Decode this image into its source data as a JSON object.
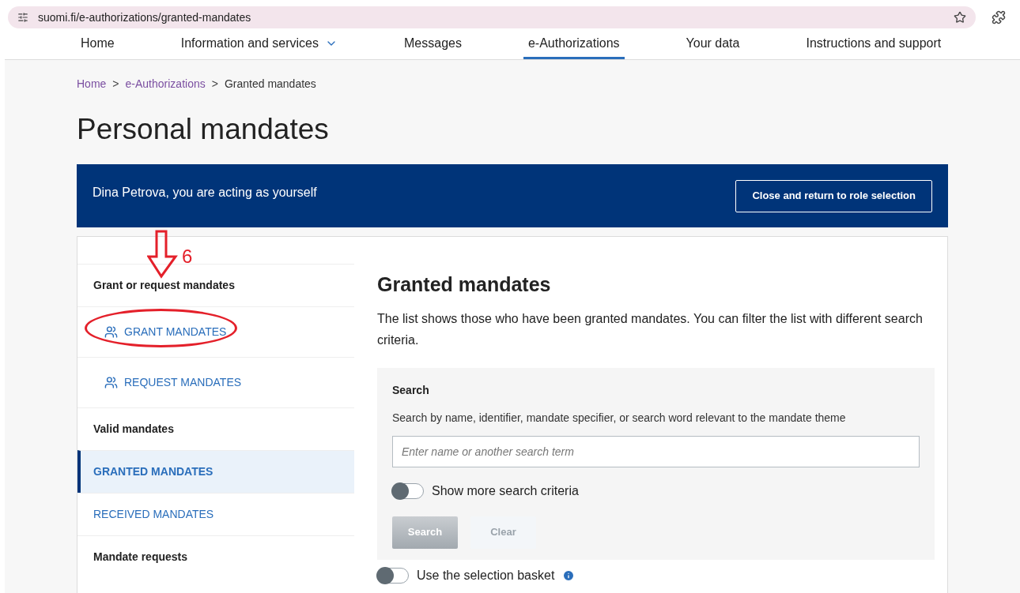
{
  "browser": {
    "url": "suomi.fi/e-authorizations/granted-mandates"
  },
  "nav": [
    {
      "label": "Home",
      "selected": false,
      "dropdown": false
    },
    {
      "label": "Information and services",
      "selected": false,
      "dropdown": true
    },
    {
      "label": "Messages",
      "selected": false,
      "dropdown": false
    },
    {
      "label": "e-Authorizations",
      "selected": true,
      "dropdown": false
    },
    {
      "label": "Your data",
      "selected": false,
      "dropdown": false
    },
    {
      "label": "Instructions and support",
      "selected": false,
      "dropdown": false
    }
  ],
  "breadcrumb": [
    {
      "label": "Home",
      "link": true
    },
    {
      "label": "e-Authorizations",
      "link": true
    },
    {
      "label": "Granted mandates",
      "link": false
    }
  ],
  "breadcrumb_separator": ">",
  "page_title": "Personal mandates",
  "banner": {
    "text": "Dina Petrova, you are acting as yourself",
    "button": "Close and return to role selection"
  },
  "sidebar": [
    {
      "kind": "heading",
      "label": "Grant or request mandates"
    },
    {
      "kind": "action",
      "label": "GRANT MANDATES"
    },
    {
      "kind": "action",
      "label": "REQUEST MANDATES"
    },
    {
      "kind": "heading",
      "label": "Valid mandates"
    },
    {
      "kind": "link",
      "label": "GRANTED MANDATES",
      "selected": true
    },
    {
      "kind": "link",
      "label": "RECEIVED MANDATES",
      "selected": false
    },
    {
      "kind": "heading",
      "label": "Mandate requests"
    }
  ],
  "content": {
    "title": "Granted mandates",
    "description": "The list shows those who have been granted mandates. You can filter the list with different search criteria.",
    "search": {
      "title": "Search",
      "hint": "Search by name, identifier, mandate specifier, or search word relevant to the mandate theme",
      "placeholder": "Enter name or another search term",
      "toggle": {
        "label": "Show more search criteria",
        "on": false
      },
      "buttons": [
        {
          "label": "Search",
          "kind": "primary",
          "disabled": true
        },
        {
          "label": "Clear",
          "kind": "secondary",
          "disabled": true
        }
      ]
    },
    "basket_toggle": {
      "label": "Use the selection basket",
      "on": false
    }
  },
  "annotation": {
    "label": "6"
  }
}
